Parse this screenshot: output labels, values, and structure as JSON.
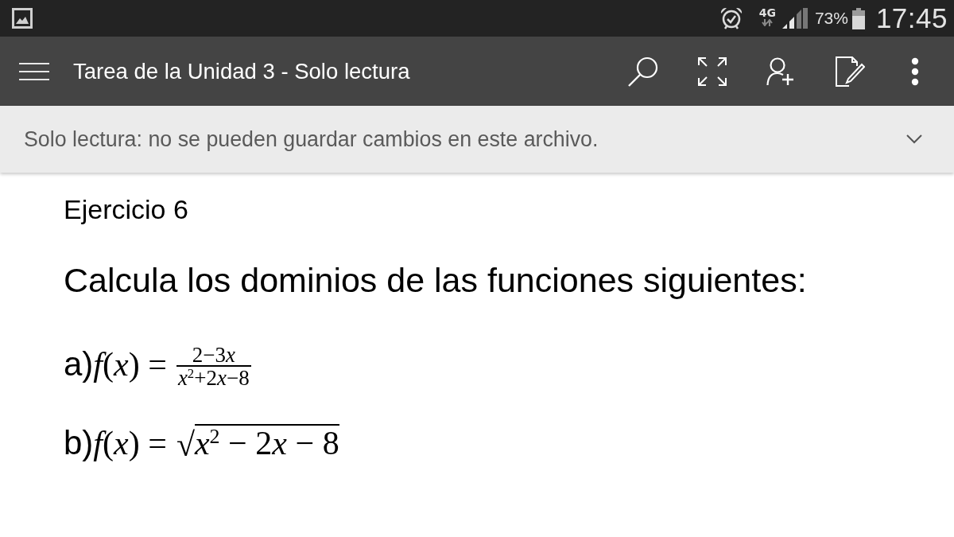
{
  "status_bar": {
    "network": "4G",
    "battery": "73%",
    "time": "17:45"
  },
  "app_bar": {
    "title": "Tarea de la Unidad 3 - Solo lectura"
  },
  "banner": {
    "message": "Solo lectura: no se pueden guardar cambios en este archivo."
  },
  "document": {
    "heading": "Ejercicio 6",
    "prompt": "Calcula los dominios de las funciones siguientes:",
    "exercises": [
      {
        "label": "a)",
        "lhs": "*f*(*x*) =",
        "kind": "fraction",
        "numerator": [
          "2−3",
          "*x*"
        ],
        "denominator": [
          "*x*$^{2}$+2",
          "*x*",
          "−8"
        ]
      },
      {
        "label": "b)",
        "lhs": "*f*(*x*) =",
        "kind": "root",
        "sign": "√",
        "radicand": [
          "*x*$^{2}$ − 2",
          "*x*",
          " − 8"
        ]
      }
    ]
  }
}
